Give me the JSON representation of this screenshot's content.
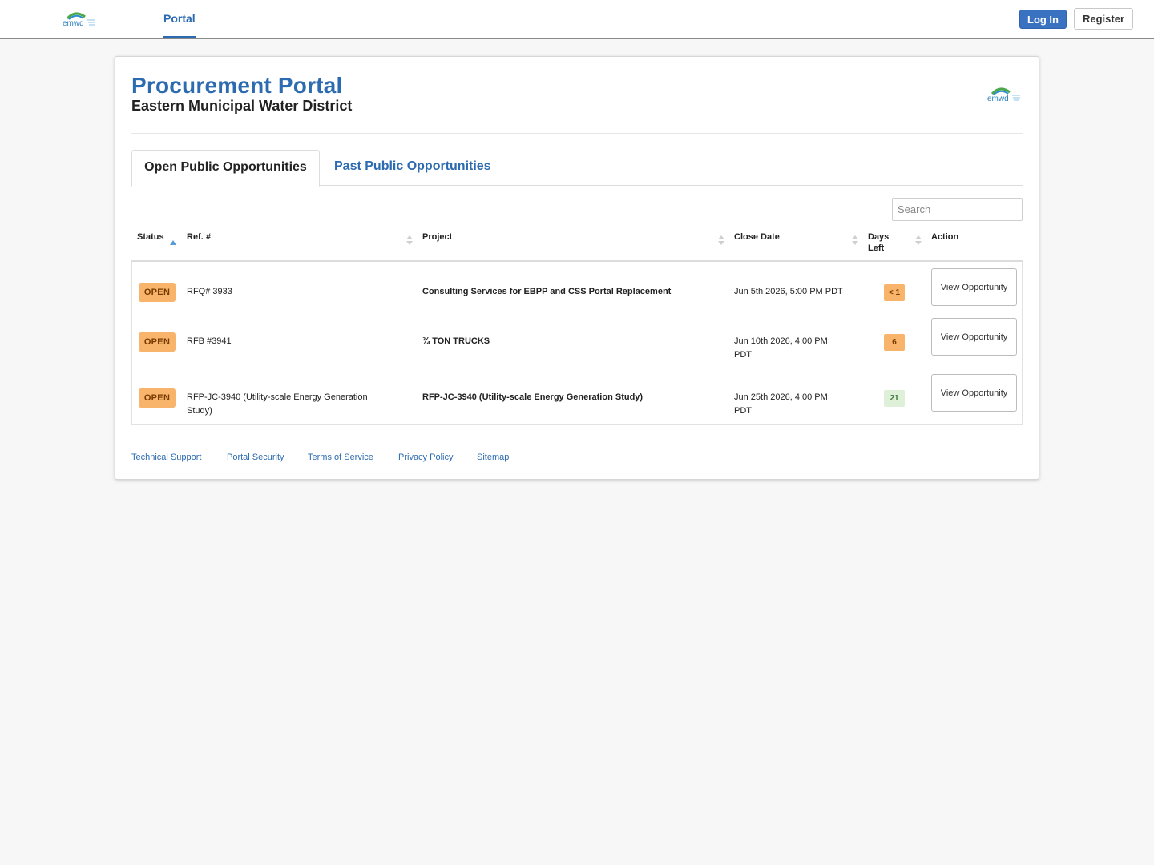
{
  "nav": {
    "logo_text": "emwd",
    "portal_label": "Portal",
    "login_label": "Log In",
    "register_label": "Register"
  },
  "header": {
    "title": "Procurement Portal",
    "subtitle": "Eastern Municipal Water District",
    "logo_text": "emwd"
  },
  "tabs": [
    {
      "label": "Open Public Opportunities",
      "active": true
    },
    {
      "label": "Past Public Opportunities",
      "active": false
    }
  ],
  "search": {
    "placeholder": "Search",
    "value": ""
  },
  "table": {
    "columns": {
      "status": "Status",
      "ref": "Ref. #",
      "project": "Project",
      "close_date": "Close Date",
      "days_left": "Days Left",
      "action": "Action"
    },
    "rows": [
      {
        "status": "OPEN",
        "ref": "RFQ# 3933",
        "project": "Consulting Services for EBPP and CSS Portal Replacement",
        "close_date": "Jun 5th 2026, 5:00 PM PDT",
        "days_left": "< 1",
        "action": "View Opportunity"
      },
      {
        "status": "OPEN",
        "ref": "RFB #3941",
        "project": "¾ TON TRUCKS",
        "close_date": "Jun 10th 2026, 4:00 PM PDT",
        "days_left": "6",
        "action": "View Opportunity"
      },
      {
        "status": "OPEN",
        "ref": "RFP-JC-3940 (Utility-scale Energy Generation Study)",
        "project": "RFP-JC-3940 (Utility-scale Energy Generation Study)",
        "close_date": "Jun 25th 2026, 4:00 PM PDT",
        "days_left": "21",
        "action": "View Opportunity"
      }
    ]
  },
  "footer": {
    "links": [
      "Technical Support",
      "Portal Security",
      "Terms of Service",
      "Privacy Policy",
      "Sitemap"
    ]
  },
  "colors": {
    "brand_blue": "#2d6bb0",
    "open_badge": "#f7b46a",
    "days_ok": "#dff0d8"
  }
}
